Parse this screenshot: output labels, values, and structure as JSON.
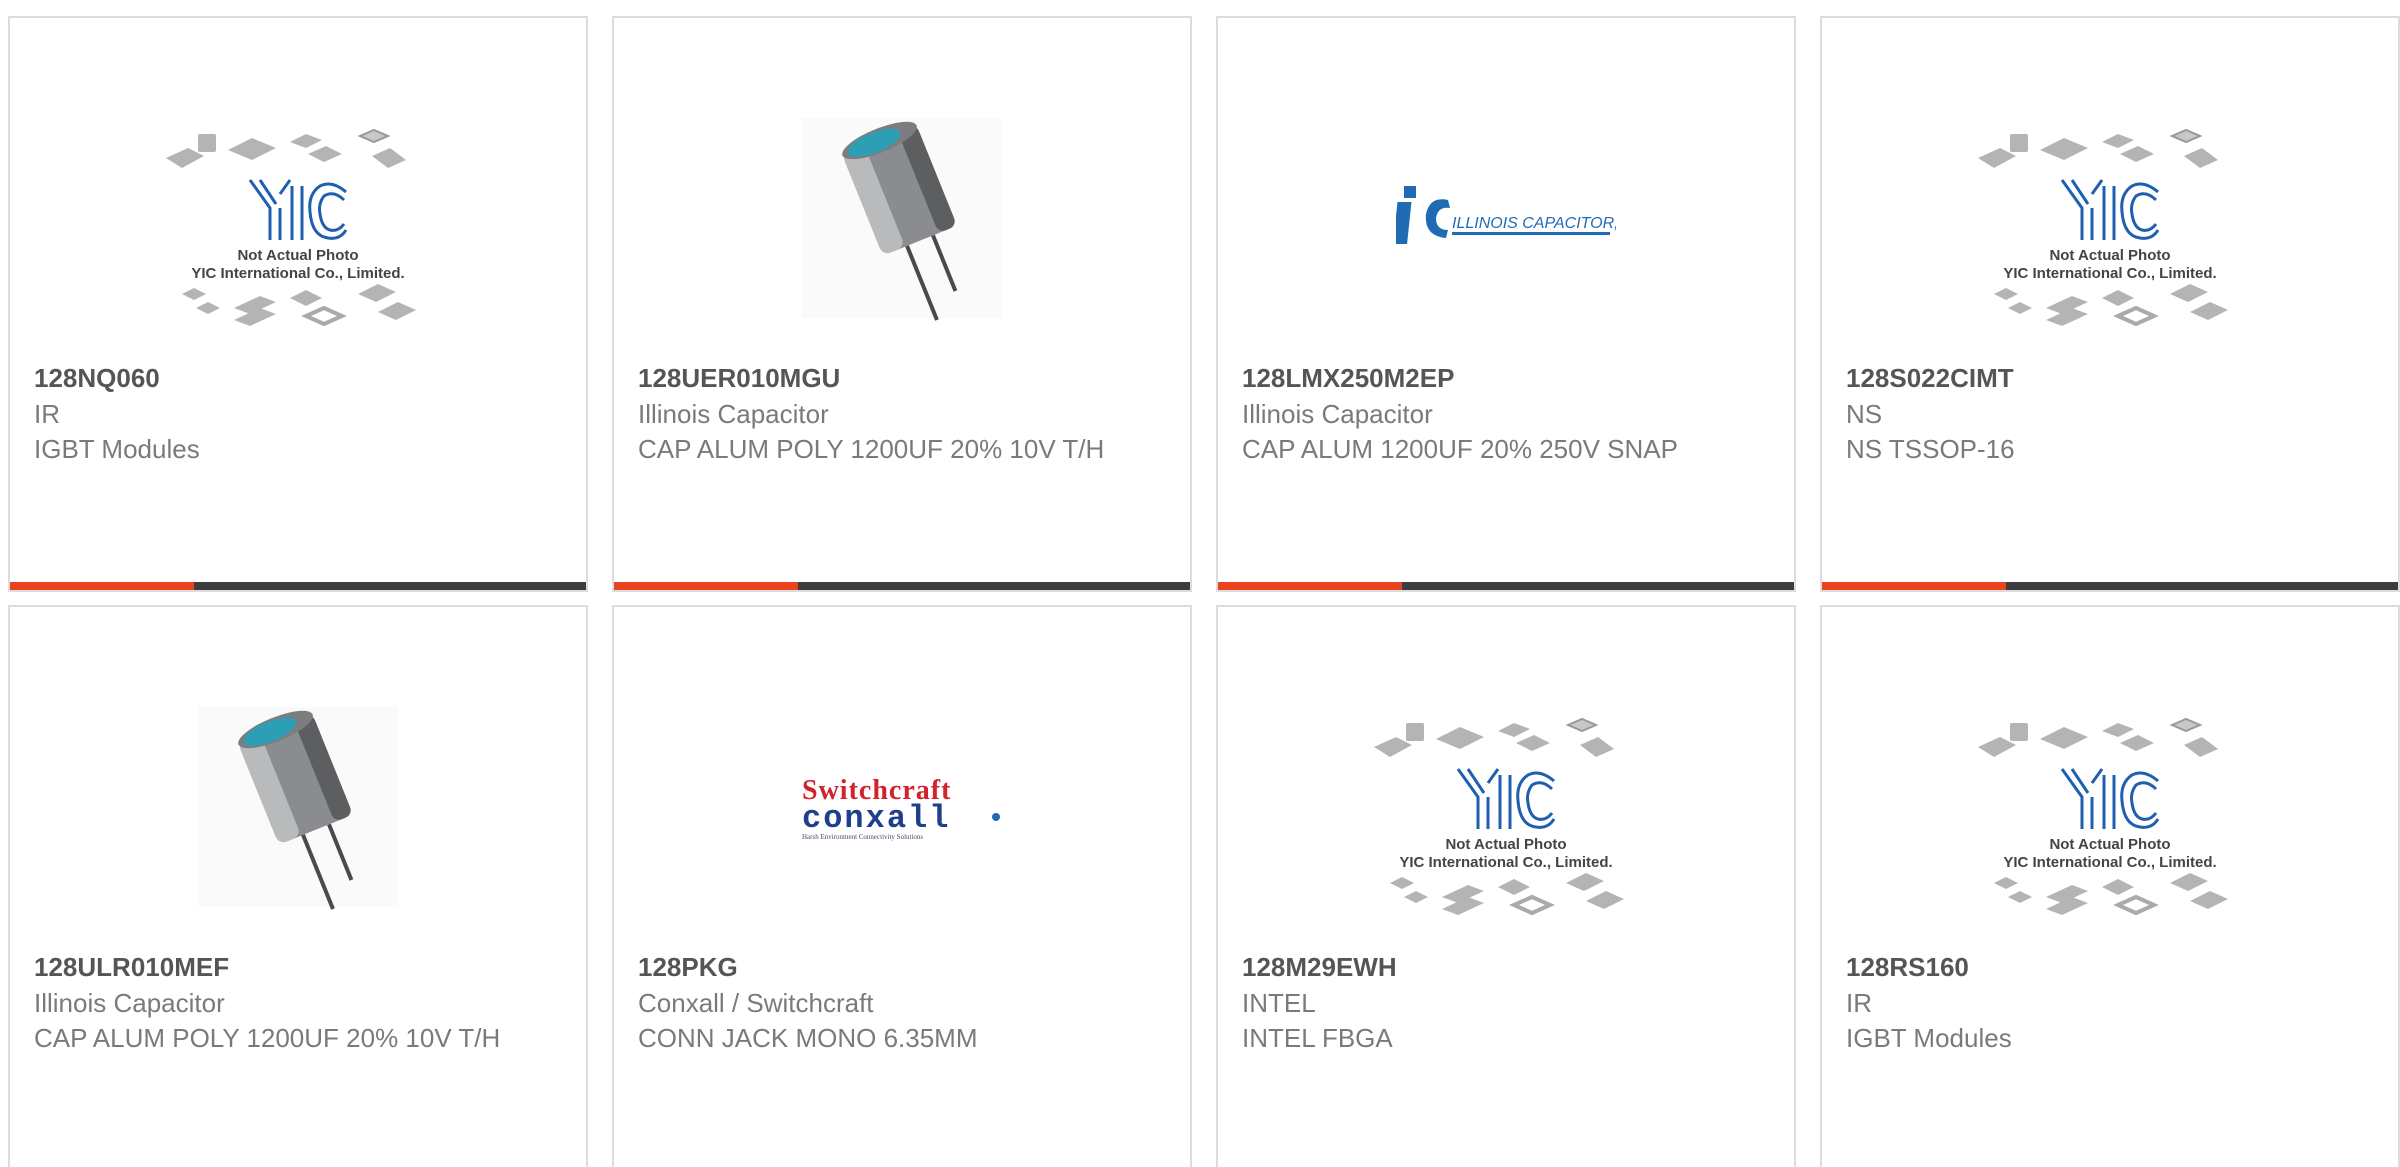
{
  "accent_color": "#e8431d",
  "bar_color": "#3d3d3d",
  "placeholder": {
    "line1": "Not Actual Photo",
    "line2": "YIC International Co., Limited."
  },
  "logos": {
    "illinois": "ILLINOIS CAPACITOR, INC.",
    "switchcraft": "Switchcraft",
    "conxall": "conxall",
    "conxall_tag": "Harsh Environment Connectivity Solutions"
  },
  "products": [
    {
      "part": "128NQ060",
      "manufacturer": "IR",
      "description": "IGBT Modules",
      "image": "yic-placeholder",
      "progress": 0.32
    },
    {
      "part": "128UER010MGU",
      "manufacturer": "Illinois Capacitor",
      "description": "CAP ALUM POLY 1200UF 20% 10V T/H",
      "image": "capacitor-photo",
      "progress": 0.32
    },
    {
      "part": "128LMX250M2EP",
      "manufacturer": "Illinois Capacitor",
      "description": "CAP ALUM 1200UF 20% 250V SNAP",
      "image": "illinois-capacitor-logo",
      "progress": 0.32
    },
    {
      "part": "128S022CIMT",
      "manufacturer": "NS",
      "description": "NS TSSOP-16",
      "image": "yic-placeholder",
      "progress": 0.32
    },
    {
      "part": "128ULR010MEF",
      "manufacturer": "Illinois Capacitor",
      "description": "CAP ALUM POLY 1200UF 20% 10V T/H",
      "image": "capacitor-photo"
    },
    {
      "part": "128PKG",
      "manufacturer": "Conxall / Switchcraft",
      "description": "CONN JACK MONO 6.35MM",
      "image": "switchcraft-conxall-logo"
    },
    {
      "part": "128M29EWH",
      "manufacturer": "INTEL",
      "description": "INTEL FBGA",
      "image": "yic-placeholder"
    },
    {
      "part": "128RS160",
      "manufacturer": "IR",
      "description": "IGBT Modules",
      "image": "yic-placeholder"
    }
  ]
}
